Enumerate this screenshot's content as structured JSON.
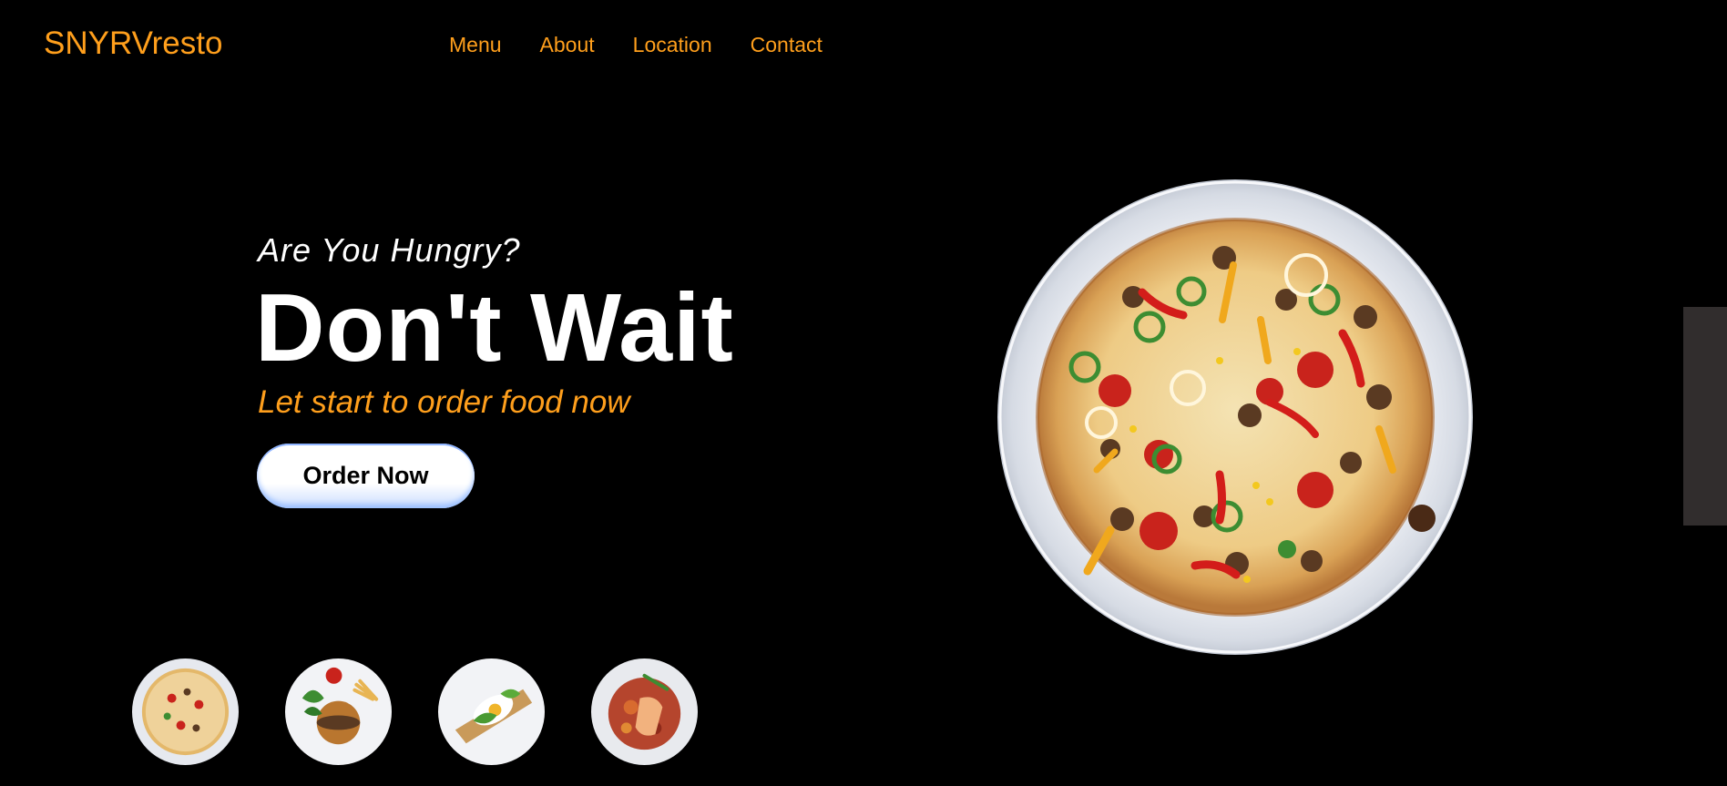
{
  "header": {
    "logo": "SNYRVresto",
    "nav": [
      "Menu",
      "About",
      "Location",
      "Contact"
    ]
  },
  "hero": {
    "kicker": "Are You Hungry?",
    "title": "Don't Wait",
    "subtitle": "Let start to order food now",
    "cta_label": "Order Now"
  },
  "images": {
    "main": "pizza-plate-image",
    "thumbnails": [
      "pizza-thumbnail",
      "burger-thumbnail",
      "toast-thumbnail",
      "salmon-salad-thumbnail"
    ]
  },
  "colors": {
    "background": "#000000",
    "accent": "#ff9f1c",
    "text": "#ffffff",
    "side_tab": "#312d2d"
  }
}
